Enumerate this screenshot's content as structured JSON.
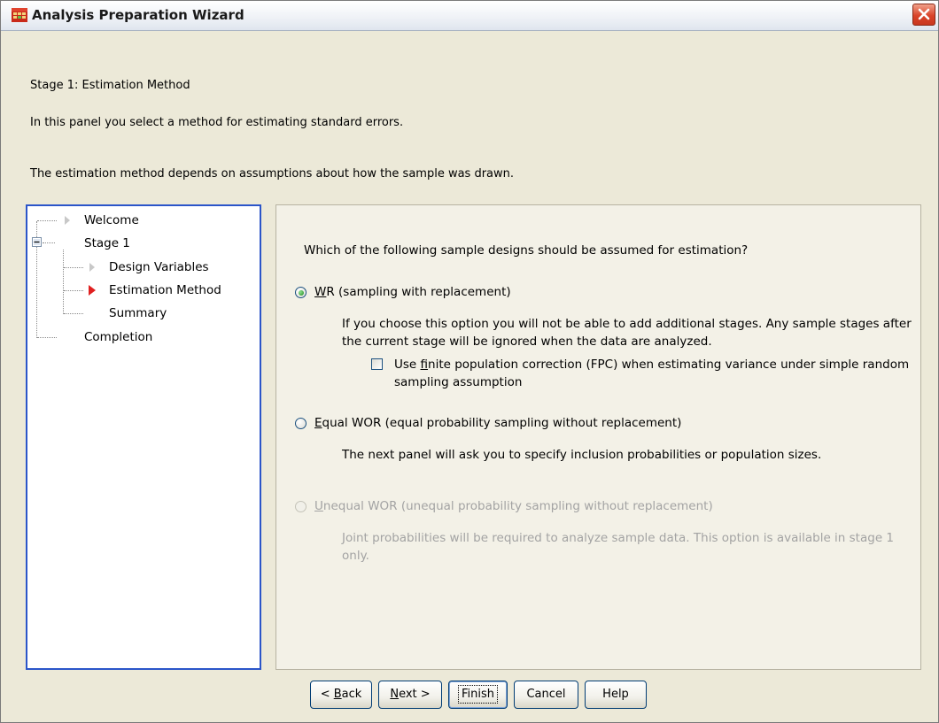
{
  "window": {
    "title": "Analysis Preparation Wizard"
  },
  "header": {
    "stage_title": "Stage 1: Estimation Method",
    "description": "In this panel you select a method for estimating standard errors.",
    "description2": "The estimation method depends on assumptions about how the sample was drawn."
  },
  "tree": {
    "items": [
      {
        "label": "Welcome"
      },
      {
        "label": "Stage 1"
      },
      {
        "label": "Design Variables"
      },
      {
        "label": "Estimation Method"
      },
      {
        "label": "Summary"
      },
      {
        "label": "Completion"
      }
    ],
    "current": "Estimation Method"
  },
  "panel": {
    "question": "Which of the following sample designs should be assumed for estimation?",
    "options": [
      {
        "mnemonic": "W",
        "label_rest": "R (sampling with replacement)",
        "selected": true,
        "enabled": true,
        "description": "If you choose this option you will not be able to add additional stages. Any sample stages after the current stage will be ignored when the data are analyzed."
      },
      {
        "mnemonic": "E",
        "label_rest": "qual WOR (equal probability sampling without replacement)",
        "selected": false,
        "enabled": true,
        "description": "The next panel will ask you to specify inclusion probabilities or population sizes."
      },
      {
        "mnemonic": "U",
        "label_rest": "nequal WOR (unequal probability sampling without replacement)",
        "selected": false,
        "enabled": false,
        "description": "Joint probabilities will be required to analyze sample data. This option is available in stage 1 only."
      }
    ],
    "fpc": {
      "prefix": "Use ",
      "mnemonic": "f",
      "rest": "inite population correction (FPC) when estimating variance under simple random sampling assumption",
      "checked": false
    }
  },
  "buttons": {
    "back_prefix": "< ",
    "back_mnemonic": "B",
    "back_rest": "ack",
    "next_mnemonic": "N",
    "next_rest": "ext >",
    "finish": "Finish",
    "cancel": "Cancel",
    "help": "Help"
  },
  "colors": {
    "tree_border": "#2b55c9",
    "current_arrow": "#e02020",
    "close_button": "#d9442a"
  }
}
